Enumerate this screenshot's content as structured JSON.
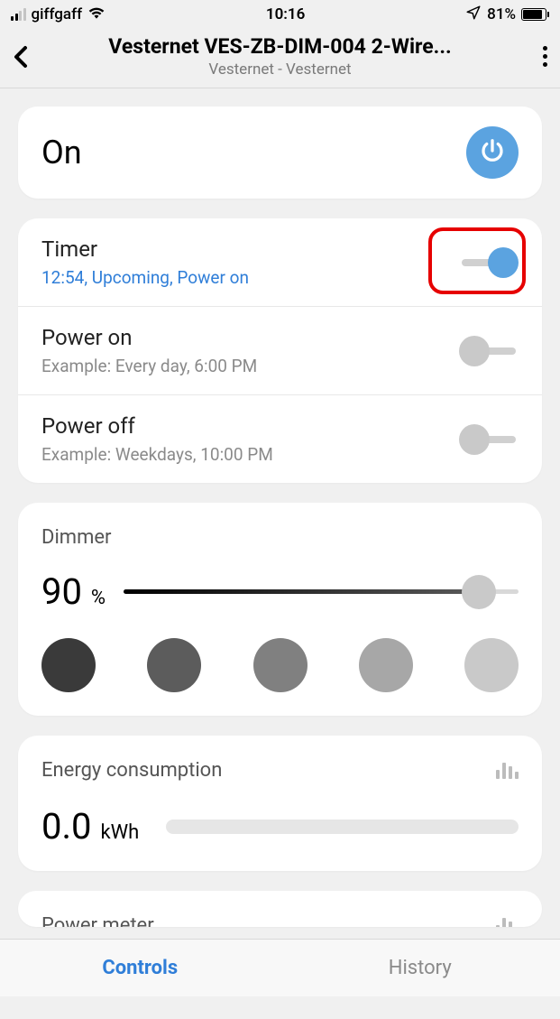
{
  "status": {
    "carrier": "giffgaff",
    "time": "10:16",
    "battery_pct": "81%"
  },
  "header": {
    "title": "Vesternet VES-ZB-DIM-004 2-Wire...",
    "subtitle": "Vesternet - Vesternet"
  },
  "on_card": {
    "state_label": "On"
  },
  "timer_row": {
    "title": "Timer",
    "subtitle": "12:54, Upcoming, Power on",
    "toggle_on": true
  },
  "power_on_row": {
    "title": "Power on",
    "subtitle": "Example: Every day, 6:00 PM",
    "toggle_on": false
  },
  "power_off_row": {
    "title": "Power off",
    "subtitle": "Example: Weekdays, 10:00 PM",
    "toggle_on": false
  },
  "dimmer": {
    "label": "Dimmer",
    "value": "90",
    "unit": "%",
    "slider_pct": 90,
    "swatches": [
      "#3a3a3a",
      "#5c5c5c",
      "#808080",
      "#a7a7a7",
      "#c9c9c9"
    ]
  },
  "energy": {
    "title": "Energy consumption",
    "value": "0.0",
    "unit": "kWh"
  },
  "power_meter": {
    "title": "Power meter"
  },
  "tabs": {
    "controls": "Controls",
    "history": "History"
  }
}
